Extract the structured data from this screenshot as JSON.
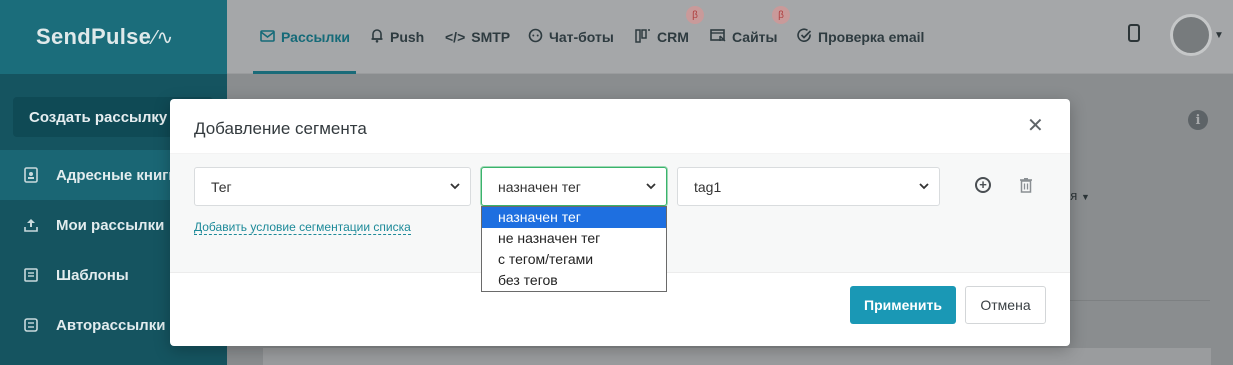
{
  "app": {
    "logo": "SendPulse"
  },
  "sidebar": {
    "create_button": "Создать рассылку",
    "items": [
      {
        "label": "Адресные книги",
        "icon": "address-book-icon"
      },
      {
        "label": "Мои рассылки",
        "icon": "upload-icon"
      },
      {
        "label": "Шаблоны",
        "icon": "template-icon"
      },
      {
        "label": "Авторассылки",
        "icon": "automation-icon"
      }
    ]
  },
  "nav": {
    "items": [
      {
        "label": "Рассылки",
        "icon": "mail-icon",
        "active": true
      },
      {
        "label": "Push",
        "icon": "bell-icon"
      },
      {
        "label": "SMTP",
        "icon": "code-icon"
      },
      {
        "label": "Чат-боты",
        "icon": "chatbot-icon"
      },
      {
        "label": "CRM",
        "icon": "crm-icon",
        "badge": "β"
      },
      {
        "label": "Сайты",
        "icon": "site-icon",
        "badge": "β"
      },
      {
        "label": "Проверка email",
        "icon": "check-circle-icon"
      }
    ]
  },
  "background": {
    "dropdown_fragment": "ия"
  },
  "modal": {
    "title": "Добавление сегмента",
    "condition": {
      "field_value": "Тег",
      "operator_value": "назначен тег",
      "tag_value": "tag1"
    },
    "operator_options": [
      "назначен тег",
      "не назначен тег",
      "с тегом/тегами",
      "без тегов"
    ],
    "selected_option_index": 0,
    "add_condition_link": "Добавить условие сегментации списка",
    "apply_button": "Применить",
    "cancel_button": "Отмена"
  },
  "colors": {
    "accent": "#1a98b5",
    "sidebar_bg": "#155460",
    "focus_border": "#3ab36c",
    "option_highlight": "#1e6fe0"
  }
}
